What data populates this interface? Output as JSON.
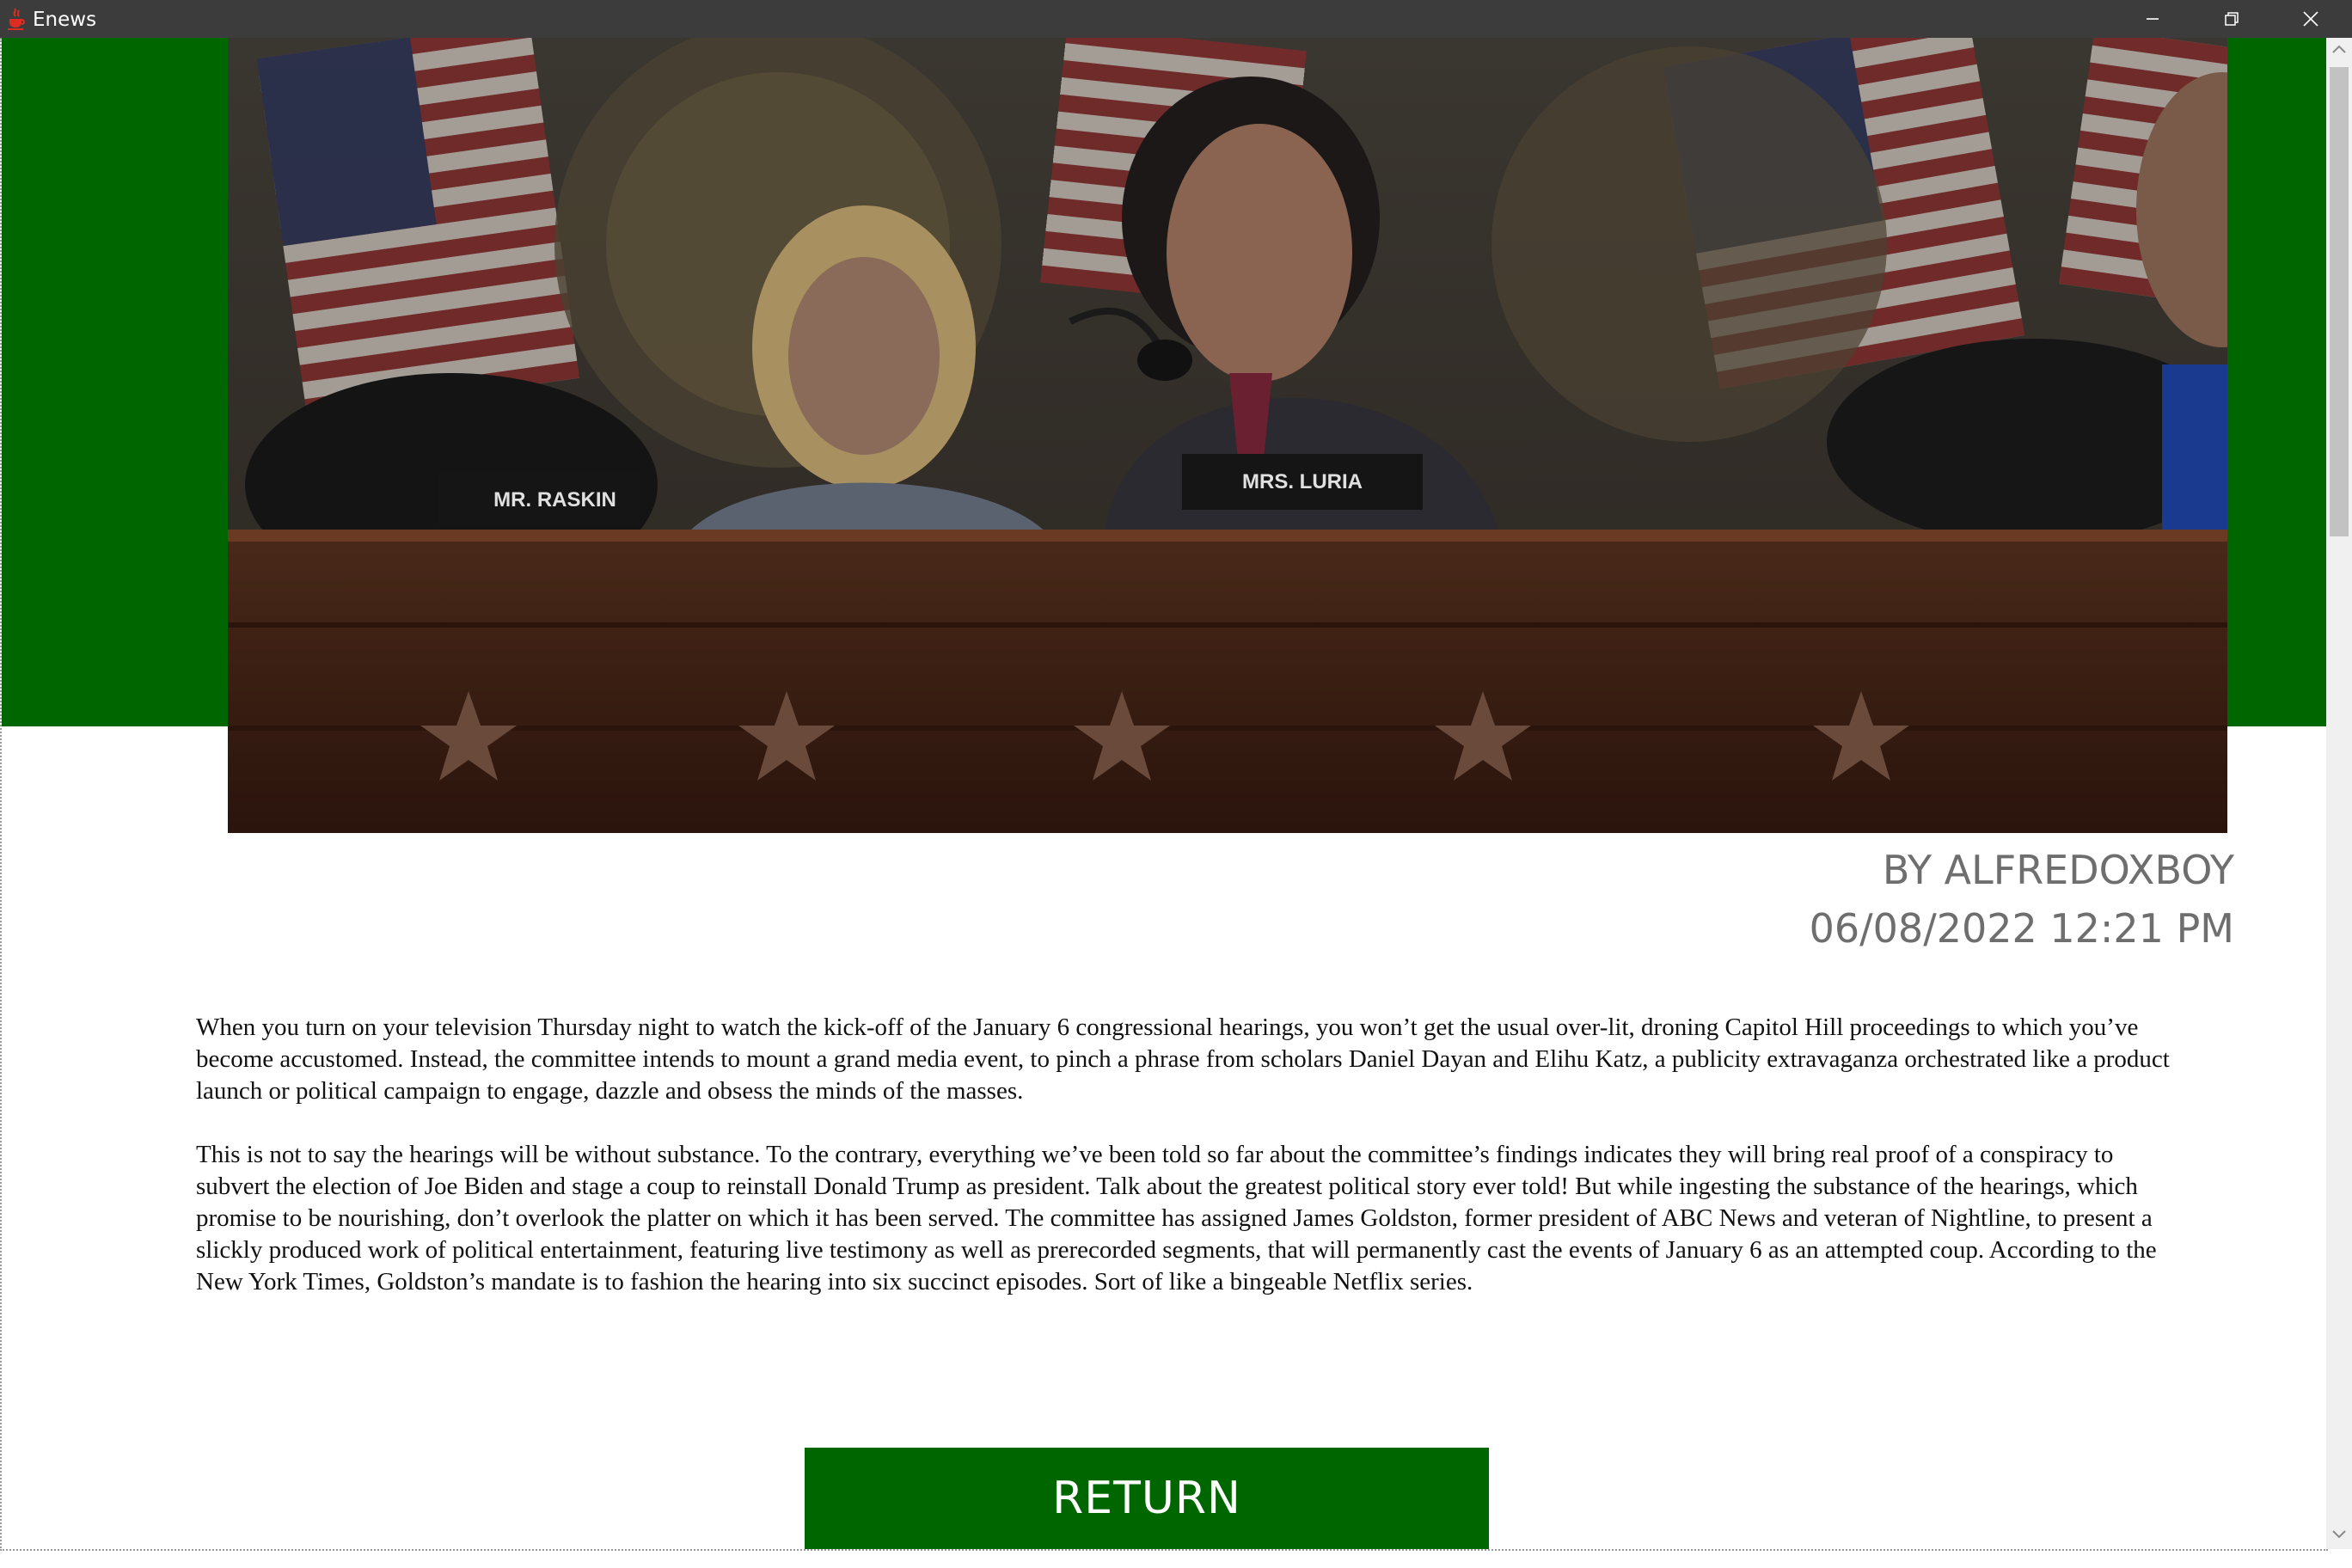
{
  "window": {
    "title": "Enews",
    "icon": "java-cup-icon",
    "controls": [
      "minimize-icon",
      "maximize-icon",
      "close-icon"
    ]
  },
  "article": {
    "hero_image": {
      "description_icon": "hearing-photo",
      "nameplates": [
        "MR. RASKIN",
        "MRS. LURIA"
      ]
    },
    "author": "BY ALFREDOXBOY",
    "datetime": "06/08/2022 12:21 PM",
    "paragraphs": [
      "When you turn on your television Thursday night to watch the kick-off of the January 6 congressional hearings, you won’t get the usual over-lit, droning Capitol Hill proceedings to which you’ve become accustomed. Instead, the committee intends to mount a grand media event, to pinch a phrase from scholars Daniel Dayan and Elihu Katz, a publicity extravaganza orchestrated like a product launch or political campaign to engage, dazzle and obsess the minds of the masses.",
      "This is not to say the hearings will be without substance. To the contrary, everything we’ve been told so far about the committee’s findings indicates they will bring real proof of a conspiracy to subvert the election of Joe Biden and stage a coup to reinstall Donald Trump as president. Talk about the greatest political story ever told! But while ingesting the substance of the hearings, which promise to be nourishing, don’t overlook the platter on which it has been served. The committee has assigned James Goldston, former president of ABC News and veteran of Nightline, to present a slickly produced work of political entertainment, featuring live testimony as well as prerecorded segments, that will permanently cast the events of January 6 as an attempted coup. According to the New York Times, Goldston’s mandate is to fashion the hearing into six succinct episodes. Sort of like a bingeable Netflix series."
    ]
  },
  "actions": {
    "return_label": "RETURN"
  },
  "colors": {
    "accent_green": "#006600",
    "titlebar": "#3c3c3c",
    "byline_gray": "#6e6e6e"
  }
}
